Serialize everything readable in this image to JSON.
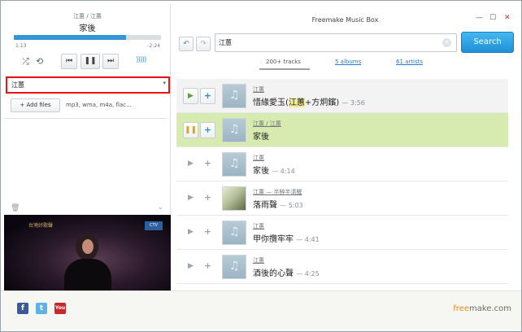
{
  "now_playing": {
    "artist_line": "江蕙 / 江蕙",
    "title": "家後",
    "progress_fraction": 0.76,
    "elapsed": "1:13",
    "remaining": "-2:24"
  },
  "controls": {
    "shuffle_icon": "⤮",
    "repeat_icon": "⟲",
    "prev_icon": "⏮",
    "pause_icon": "❚❚",
    "next_icon": "⏭",
    "volume_icon": ")))))"
  },
  "playlist": {
    "selected": "江蕙",
    "add_files_label": "+ Add files",
    "formats": "mp3, wma, m4a, flac..."
  },
  "video": {
    "caption": "台灣好歌聲",
    "logo_text": "CTV"
  },
  "app": {
    "title": "Freemake Music Box",
    "minimize": "—",
    "maximize": "☐",
    "close": "✕"
  },
  "search": {
    "back_icon": "↶",
    "forward_icon": "↷",
    "value": "江蕙",
    "button_label": "Search"
  },
  "tabs": {
    "tracks": "200+ tracks",
    "albums": "5 albums",
    "artists": "61 artists"
  },
  "tracks": [
    {
      "artist": "江蕙",
      "title_pre": "惜緣愛玉(",
      "title_hl": "江蕙",
      "title_post": "+方炯鑌)",
      "duration": "— 3:56",
      "state": "hover"
    },
    {
      "artist": "江蕙 / 江蕙",
      "title_pre": "家後",
      "title_hl": "",
      "title_post": "",
      "duration": "",
      "state": "playing"
    },
    {
      "artist": "江蕙",
      "title_pre": "家後",
      "title_hl": "",
      "title_post": "",
      "duration": "— 4:14",
      "state": "normal"
    },
    {
      "artist": "江蕙 — 半醉半清醒",
      "title_pre": "落雨聲",
      "title_hl": "",
      "title_post": "",
      "duration": "— 5:03",
      "state": "normal"
    },
    {
      "artist": "江蕙",
      "title_pre": "甲你攬牢牢",
      "title_hl": "",
      "title_post": "",
      "duration": "— 4:41",
      "state": "normal"
    },
    {
      "artist": "江蕙",
      "title_pre": "酒後的心聲",
      "title_hl": "",
      "title_post": "",
      "duration": "— 4:25",
      "state": "normal"
    }
  ],
  "footer": {
    "facebook": "f",
    "twitter": "t",
    "youtube": "You",
    "brand_free": "free",
    "brand_make": "make.com"
  },
  "colors": {
    "accent": "#3496d4",
    "playing_row": "#d7ebb0",
    "highlight_red": "#e8141a",
    "search_button": "#1e8fd6"
  }
}
